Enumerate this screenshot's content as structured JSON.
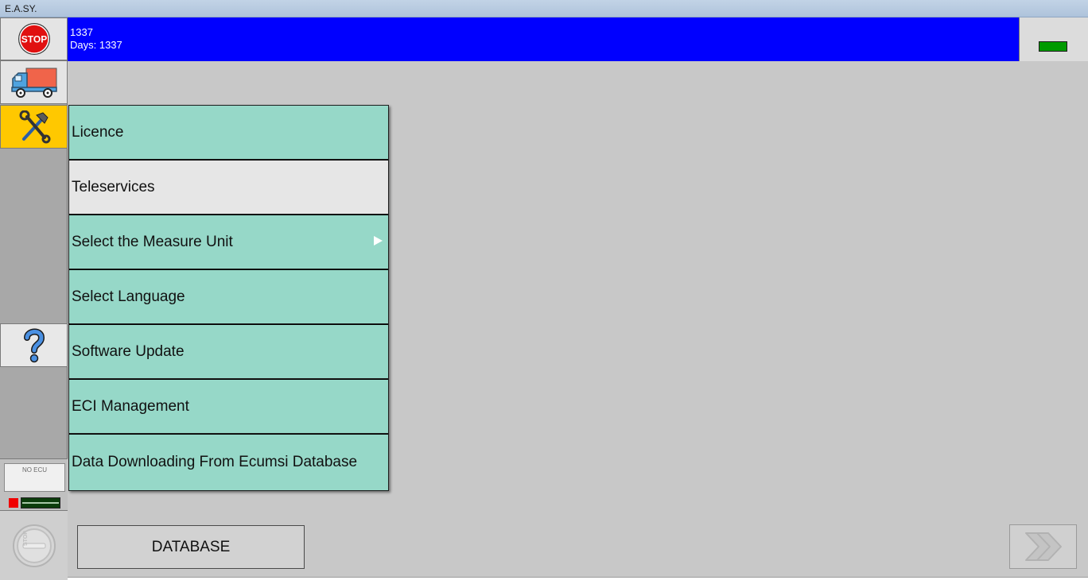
{
  "window": {
    "title": "E.A.SY."
  },
  "header": {
    "line1": "1337",
    "line2": "Days: 1337"
  },
  "sidebar": {
    "stop_label": "STOP",
    "ecu_status": "NO ECU",
    "stop_key_label": "STOP"
  },
  "menu": {
    "items": [
      {
        "label": "Licence",
        "has_submenu": false
      },
      {
        "label": "Teleservices",
        "has_submenu": false
      },
      {
        "label": "Select the Measure Unit",
        "has_submenu": true
      },
      {
        "label": "Select Language",
        "has_submenu": false
      },
      {
        "label": "Software Update",
        "has_submenu": false
      },
      {
        "label": "ECI Management",
        "has_submenu": false
      },
      {
        "label": "Data Downloading From Ecumsi Database",
        "has_submenu": false
      }
    ]
  },
  "footer": {
    "database_button": "DATABASE"
  },
  "colors": {
    "header_bg": "#0000ff",
    "menu_item_bg": "#96d8c8",
    "menu_item_selected_bg": "#e6e6e6",
    "tools_button_bg": "#ffc800",
    "status_led": "#009a00",
    "ecu_error": "#f00000"
  },
  "icons": [
    "stop-sign-icon",
    "truck-icon",
    "tools-icon",
    "help-icon",
    "stop-key-icon",
    "double-chevron-right-icon",
    "submenu-arrow-icon"
  ]
}
